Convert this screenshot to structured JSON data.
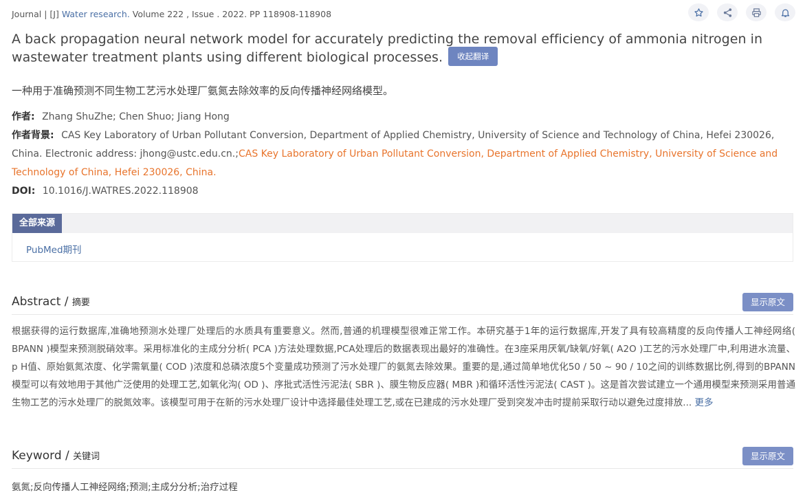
{
  "meta": {
    "prefix": "Journal | [J]",
    "journal": "Water research.",
    "details": "Volume 222 , Issue . 2022. PP 118908-118908"
  },
  "actions": {
    "favorite_icon": "star-icon",
    "share_icon": "share-icon",
    "print_icon": "print-icon",
    "notify_icon": "bell-icon"
  },
  "title_en": "A back propagation neural network model for accurately predicting the removal efficiency of ammonia nitrogen in wastewater treatment plants using different biological processes.",
  "translate_label": "收起翻译",
  "title_cn": "一种用于准确预测不同生物工艺污水处理厂氨氮去除效率的反向传播神经网络模型。",
  "authors": {
    "label": "作者:",
    "value": "Zhang ShuZhe; Chen Shuo; Jiang Hong"
  },
  "affiliation": {
    "label": "作者背景:",
    "part1": "CAS Key Laboratory of Urban Pollutant Conversion, Department of Applied Chemistry, University of Science and Technology of China, Hefei 230026, China. Electronic address: jhong@ustc.edu.cn.;",
    "part2": "CAS Key Laboratory of Urban Pollutant Conversion, Department of Applied Chemistry, University of Science and Technology of China, Hefei 230026, China."
  },
  "doi": {
    "label": "DOI:",
    "value": "10.1016/J.WATRES.2022.118908"
  },
  "sources": {
    "tab": "全部来源",
    "items": [
      "PubMed期刊"
    ]
  },
  "abstract": {
    "title": "Abstract /",
    "title_cn": "摘要",
    "show_original": "显示原文",
    "text": "根据获得的运行数据库,准确地预测水处理厂处理后的水质具有重要意义。然而,普通的机理模型很难正常工作。本研究基于1年的运行数据库,开发了具有较高精度的反向传播人工神经网络( BPANN )模型来预测脱硝效率。采用标准化的主成分分析( PCA )方法处理数据,PCA处理后的数据表现出最好的准确性。在3座采用厌氧/缺氧/好氧( A2O )工艺的污水处理厂中,利用进水流量、p H值、原始氨氮浓度、化学需氧量( COD )浓度和总磷浓度5个变量成功预测了污水处理厂的氨氮去除效果。重要的是,通过简单地优化50 / 50 ~ 90 / 10之间的训练数据比例,得到的BPANN模型可以有效地用于其他广泛使用的处理工艺,如氧化沟( OD )、序批式活性污泥法( SBR )、膜生物反应器( MBR )和循环活性污泥法( CAST )。这是首次尝试建立一个通用模型来预测采用普通生物工艺的污水处理厂的脱氮效率。该模型可用于在新的污水处理厂设计中选择最佳处理工艺,或在已建成的污水处理厂受到突发冲击时提前采取行动以避免过度排放...",
    "more": "更多"
  },
  "keyword": {
    "title": "Keyword /",
    "title_cn": "关键词",
    "show_original": "显示原文",
    "text": "氨氮;反向传播人工神经网络;预测;主成分分析;治疗过程"
  }
}
